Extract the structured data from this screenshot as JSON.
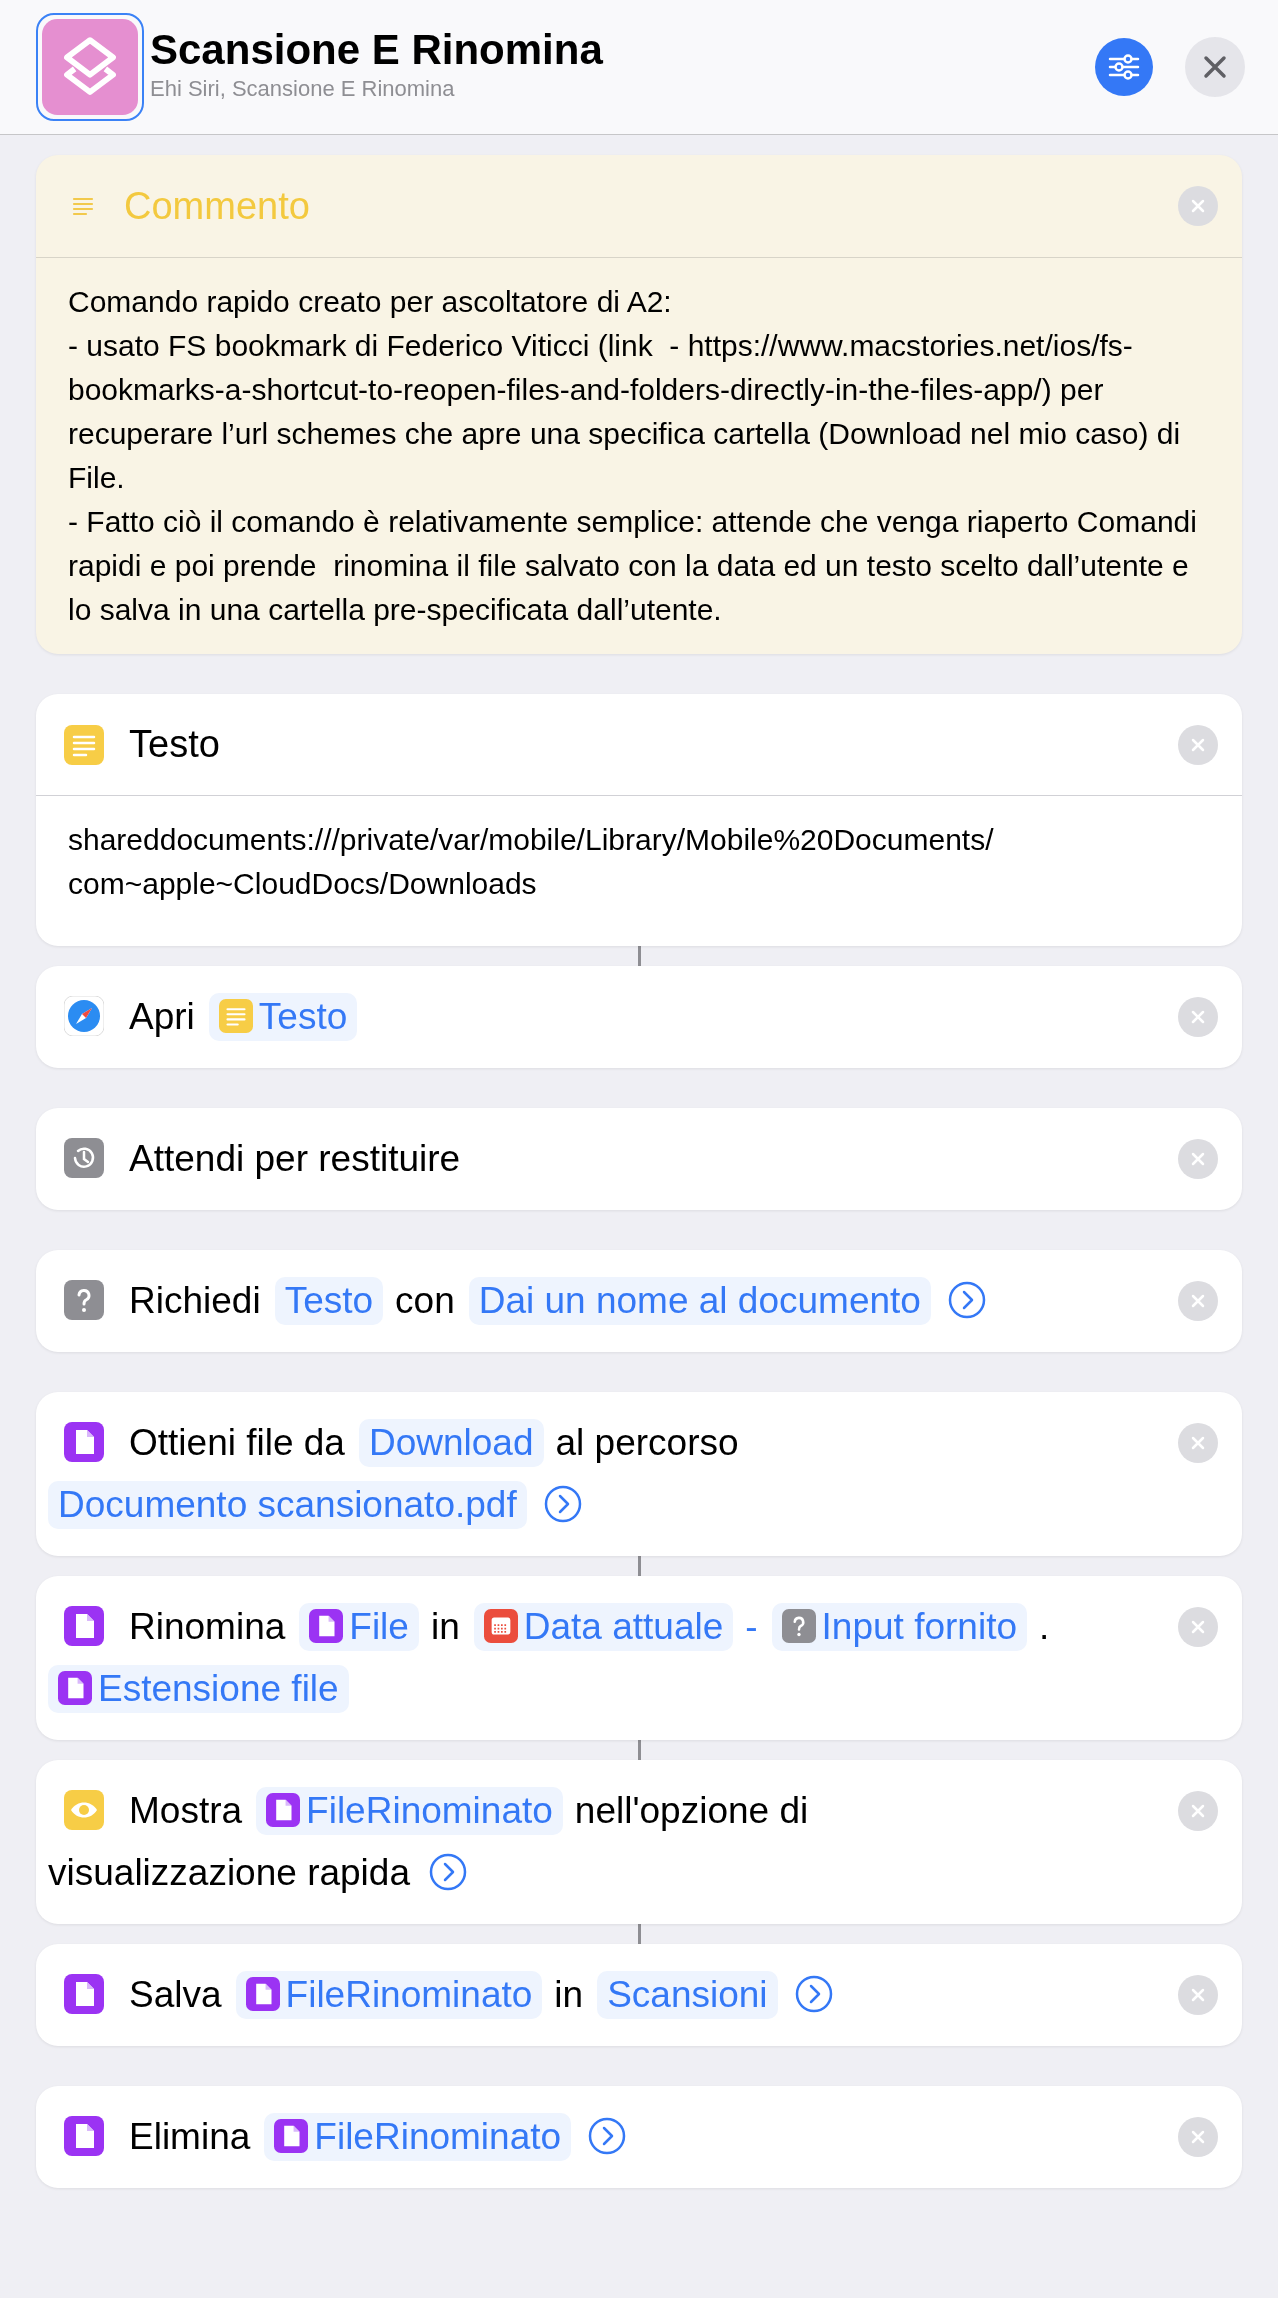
{
  "header": {
    "title": "Scansione E Rinomina",
    "subtitle": "Ehi Siri, Scansione E Rinomina"
  },
  "comment": {
    "title": "Commento",
    "text": "Comando rapido creato per ascoltatore di A2:\n- usato FS bookmark di Federico Viticci (link  - https://www.macstories.net/ios/fs-bookmarks-a-shortcut-to-reopen-files-and-folders-directly-in-the-files-app/) per recuperare l’url schemes che apre una specifica cartella (Download nel mio caso) di File.\n- Fatto ciò il comando è relativamente semplice: attende che venga riaperto Comandi rapidi e poi prende  rinomina il file salvato con la data ed un testo scelto dall’utente e lo salva in una cartella pre-specificata dall’utente."
  },
  "actions": [
    {
      "kind": "text_block",
      "title": "Testo",
      "body": "shareddocuments:///private/var/mobile/Library/Mobile%20Documents/com~apple~CloudDocs/Downloads",
      "connected_below": true
    },
    {
      "kind": "open_url",
      "parts": [
        {
          "kind": "word",
          "text": "Apri"
        },
        {
          "kind": "text_token",
          "text": "Testo"
        }
      ],
      "connected_below": false
    },
    {
      "kind": "wait",
      "parts": [
        {
          "kind": "word",
          "text": "Attendi per restituire"
        }
      ],
      "connected_below": false
    },
    {
      "kind": "ask",
      "parts": [
        {
          "kind": "word",
          "text": "Richiedi"
        },
        {
          "kind": "token",
          "text": "Testo"
        },
        {
          "kind": "word",
          "text": "con"
        },
        {
          "kind": "token",
          "text": "Dai un nome al documento"
        },
        {
          "kind": "more"
        }
      ],
      "connected_below": false
    },
    {
      "kind": "file",
      "parts": [
        {
          "kind": "word",
          "text": "Ottieni file da"
        },
        {
          "kind": "token",
          "text": "Download"
        },
        {
          "kind": "word",
          "text": "al percorso"
        },
        {
          "kind": "token",
          "text": "Documento scansionato.pdf"
        },
        {
          "kind": "more"
        }
      ],
      "connected_below": true
    },
    {
      "kind": "file",
      "parts": [
        {
          "kind": "word",
          "text": "Rinomina"
        },
        {
          "kind": "file_token",
          "text": "File"
        },
        {
          "kind": "word",
          "text": "in"
        },
        {
          "kind": "date_token",
          "text": "Data attuale"
        },
        {
          "kind": "symbol",
          "text": "-"
        },
        {
          "kind": "input_token",
          "text": "Input fornito"
        },
        {
          "kind": "word",
          "text": "."
        },
        {
          "kind": "file_token",
          "text": "Estensione file"
        }
      ],
      "connected_below": true
    },
    {
      "kind": "quick_look",
      "parts": [
        {
          "kind": "word",
          "text": "Mostra"
        },
        {
          "kind": "file_token",
          "text": "FileRinominato"
        },
        {
          "kind": "word",
          "text": "nell'opzione di"
        },
        {
          "kind": "word",
          "text": "visualizzazione rapida"
        },
        {
          "kind": "more"
        }
      ],
      "connected_below": true
    },
    {
      "kind": "file",
      "parts": [
        {
          "kind": "word",
          "text": "Salva"
        },
        {
          "kind": "file_token",
          "text": "FileRinominato"
        },
        {
          "kind": "word",
          "text": "in"
        },
        {
          "kind": "token",
          "text": "Scansioni"
        },
        {
          "kind": "more"
        }
      ],
      "connected_below": false
    },
    {
      "kind": "file",
      "parts": [
        {
          "kind": "word",
          "text": "Elimina"
        },
        {
          "kind": "file_token",
          "text": "FileRinominato"
        },
        {
          "kind": "more"
        }
      ]
    }
  ]
}
